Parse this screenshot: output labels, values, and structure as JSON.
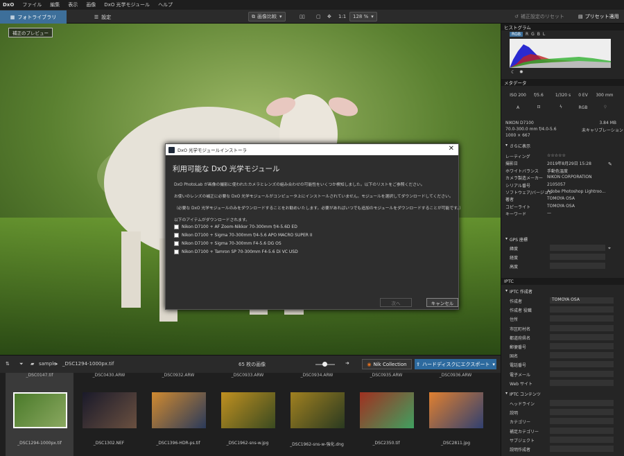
{
  "app": {
    "logo": "DxO",
    "menu": [
      "ファイル",
      "編集",
      "表示",
      "画像",
      "DxO 光学モジュール",
      "ヘルプ"
    ]
  },
  "toolbar": {
    "tab_library": "フォトライブラリ",
    "tab_settings": "設定",
    "compare": "画像比較",
    "ratio": "1:1",
    "zoom": "128 %",
    "reset": "補正設定のリセット",
    "preset": "プリセット適用"
  },
  "viewer": {
    "preview_label": "補正のプレビュー"
  },
  "dialog": {
    "title": "DxO 光学モジュールインストーラ",
    "heading": "利用可能な DxO 光学モジュール",
    "p1": "DxO PhotoLab が画像の撮影に使われたカメラとレンズの組み合わせの可能性をいくつか検知しました。以下のリストをご参照ください。",
    "p2": "お使いのレンズの補正に必要な DxO 光学モジュールがコンピュータ上にインストールされていません。モジュールを選択してダウンロードしてください。",
    "p3": "（必要な DxO 光学モジュールのみをダウンロードすることをお勧めいたします。必要があればいつでも追加のモジュールをダウンロードすることが可能です。）",
    "p4": "以下のアイテムがダウンロードされます。",
    "items": [
      "Nikon D7100 + AF Zoom-Nikkor 70-300mm f/4-5.6D ED",
      "Nikon D7100 + Sigma 70-300mm f/4-5.6 APO MACRO SUPER II",
      "Nikon D7100 + Sigma 70-300mm F4-5.6 DG OS",
      "Nikon D7100 + Tamron SP 70-300mm F4-5.6 Di VC USD"
    ],
    "next": "次へ",
    "cancel": "キャンセル"
  },
  "filmbar": {
    "folder": "sample",
    "file": "_DSC1294-1000px.tif",
    "count": "65 枚の画像",
    "nik": "Nik Collection",
    "export": "ハードディスクにエクスポート"
  },
  "thumbs": [
    {
      "top": "_DSC0147.tif",
      "bottom": "_DSC1294-1000px.tif",
      "c1": "#4a7a2a",
      "c2": "#8aa860"
    },
    {
      "top": "_DSC0430.ARW",
      "bottom": "_DSC1302.NEF",
      "c1": "#1a1a2a",
      "c2": "#6a5040"
    },
    {
      "top": "_DSC0932.ARW",
      "bottom": "_DSC1396-HDR-ps.tif",
      "c1": "#d08a30",
      "c2": "#2a3a5a"
    },
    {
      "top": "_DSC0933.ARW",
      "bottom": "_DSC1962-sns-w.jpg",
      "c1": "#c09020",
      "c2": "#3a4a20"
    },
    {
      "top": "_DSC0934.ARW",
      "bottom": "_DSC1962-sns-w-強化.dng",
      "c1": "#a08020",
      "c2": "#2a3a20"
    },
    {
      "top": "_DSC0935.ARW",
      "bottom": "_DSC2350.tif",
      "c1": "#a03020",
      "c2": "#40a060"
    },
    {
      "top": "_DSC0936.ARW",
      "bottom": "_DSC2811.jpg",
      "c1": "#e08030",
      "c2": "#304070"
    }
  ],
  "panel": {
    "histogram": "ヒストグラム",
    "hist_tabs": [
      "RGB",
      "R",
      "G",
      "B",
      "L"
    ],
    "metadata": "メタデータ",
    "exif": [
      "ISO 200",
      "f/5.6",
      "1/320 s",
      "0 EV",
      "300 mm"
    ],
    "exif2": [
      "A",
      "RGB"
    ],
    "camera": "NIKON D7100",
    "size": "3.84 MB",
    "lens": "70.0-300.0 mm f/4.0-5.6",
    "calib": "未キャリブレーション",
    "dims": "1000 × 667",
    "more": "さらに表示",
    "rows": [
      [
        "レーティング",
        "☆☆☆☆☆"
      ],
      [
        "撮影日",
        "2019年8月29日 15:28"
      ],
      [
        "ホワイトバランス",
        "手動色温度"
      ],
      [
        "カメラ製造メーカー",
        "NIKON CORPORATION"
      ],
      [
        "シリアル番号",
        "2105057"
      ],
      [
        "ソフトウェア/バージョン",
        "Adobe Photoshop Lightroo..."
      ],
      [
        "著者",
        "TOMOYA OSA"
      ],
      [
        "コピーライト",
        "TOMOYA OSA"
      ],
      [
        "キーワード",
        "—"
      ]
    ],
    "gps": "GPS 座標",
    "gps_rows": [
      "緯度",
      "経度",
      "高度"
    ],
    "iptc": "IPTC",
    "iptc_creator": "IPTC 作成者",
    "creator_rows": [
      "作成者",
      "作成者 役職",
      "住所",
      "市区町村名",
      "都道府県名",
      "郵便番号",
      "国名",
      "電話番号",
      "電子メール",
      "Web サイト"
    ],
    "creator_value": "TOMOYA OSA",
    "iptc_content": "IPTC コンテンツ",
    "content_rows": [
      "ヘッドライン",
      "説明",
      "カテゴリー",
      "補足カテゴリー",
      "サブジェクト",
      "説明作成者"
    ]
  }
}
